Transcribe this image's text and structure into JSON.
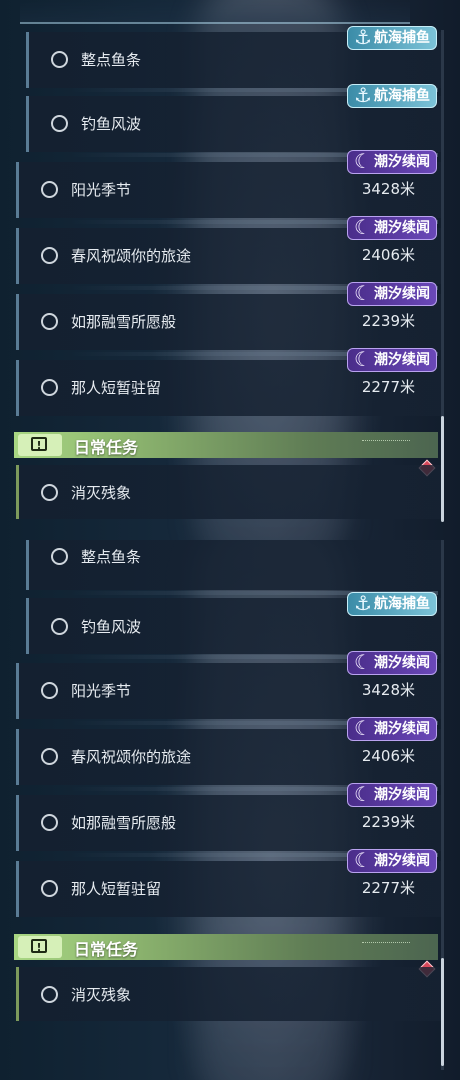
{
  "panels": [
    {
      "sub_quests": [
        {
          "label": "整点鱼条",
          "badge": "航海捕鱼"
        },
        {
          "label": "钓鱼风波",
          "badge": "航海捕鱼"
        }
      ],
      "main_quests": [
        {
          "label": "阳光季节",
          "badge": "潮汐续闻",
          "distance": "3428米"
        },
        {
          "label": "春风祝颂你的旅途",
          "badge": "潮汐续闻",
          "distance": "2406米"
        },
        {
          "label": "如那融雪所愿般",
          "badge": "潮汐续闻",
          "distance": "2239米"
        },
        {
          "label": "那人短暂驻留",
          "badge": "潮汐续闻",
          "distance": "2277米"
        }
      ],
      "category": {
        "title": "日常任务",
        "icon": "exclamation-box-icon"
      },
      "daily_quests": [
        {
          "label": "消灭残象"
        }
      ]
    },
    {
      "sub_quests": [
        {
          "label": "整点鱼条",
          "badge": ""
        },
        {
          "label": "钓鱼风波",
          "badge": "航海捕鱼"
        }
      ],
      "main_quests": [
        {
          "label": "阳光季节",
          "badge": "潮汐续闻",
          "distance": "3428米"
        },
        {
          "label": "春风祝颂你的旅途",
          "badge": "潮汐续闻",
          "distance": "2406米"
        },
        {
          "label": "如那融雪所愿般",
          "badge": "潮汐续闻",
          "distance": "2239米"
        },
        {
          "label": "那人短暂驻留",
          "badge": "潮汐续闻",
          "distance": "2277米"
        }
      ],
      "category": {
        "title": "日常任务",
        "icon": "exclamation-box-icon"
      },
      "daily_quests": [
        {
          "label": "消灭残象"
        }
      ]
    }
  ],
  "colors": {
    "sea_badge": "#5aa8c2",
    "tide_badge": "#5a3aa6",
    "daily_header": "#a9d783",
    "marker": "#d8485a"
  }
}
